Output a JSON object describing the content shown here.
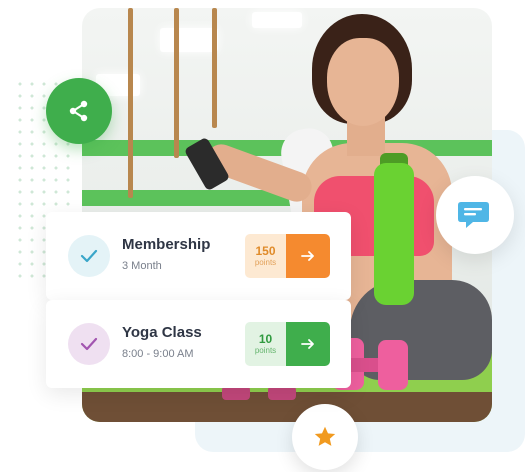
{
  "colors": {
    "accent_green": "#3fae4c",
    "accent_orange": "#f58a2f",
    "check_blue": "#3aa6c9",
    "check_purple": "#a255b0",
    "chat_blue": "#4fb6e6",
    "star_orange": "#f19a1f"
  },
  "icons": {
    "share": "share-icon",
    "chat": "chat-bubble-icon",
    "star": "star-icon",
    "check": "check-icon",
    "arrow": "arrow-right-icon"
  },
  "cards": [
    {
      "title": "Membership",
      "subtitle": "3 Month",
      "points": "150",
      "points_unit": "points",
      "theme": "orange"
    },
    {
      "title": "Yoga Class",
      "subtitle": "8:00 - 9:00 AM",
      "points": "10",
      "points_unit": "points",
      "theme": "green"
    }
  ]
}
